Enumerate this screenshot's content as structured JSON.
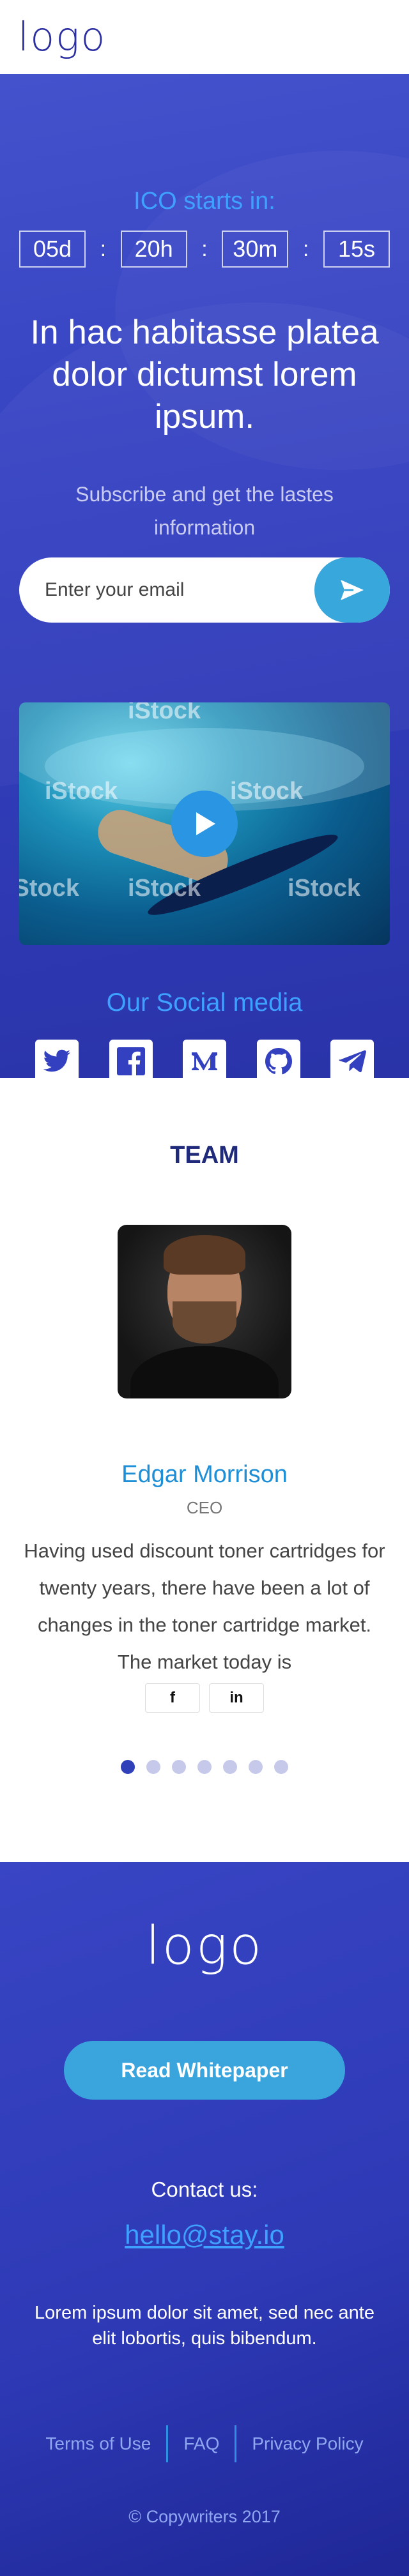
{
  "header": {
    "logo_text": "logo"
  },
  "hero": {
    "ico_title": "ICO starts in:",
    "countdown": [
      {
        "value": "05d"
      },
      {
        "value": "20h"
      },
      {
        "value": "30m"
      },
      {
        "value": "15s"
      }
    ],
    "countdown_separator": ":",
    "heading": "In hac habitasse platea dolor dictumst lorem ipsum.",
    "subscribe_text": "Subscribe and get the lastes information",
    "email_placeholder": "Enter your email",
    "video": {
      "watermark": "iStock"
    },
    "social_title": "Our Social media",
    "social_icons": [
      "twitter-icon",
      "facebook-icon",
      "medium-icon",
      "github-icon",
      "telegram-icon"
    ]
  },
  "team": {
    "title": "TEAM",
    "member": {
      "name": "Edgar Morrison",
      "role": "CEO",
      "bio": "Having used discount toner cartridges for twenty years, there have been a lot of changes in the toner cartridge market. The market today is",
      "social": [
        {
          "label": "f",
          "icon": "facebook-icon"
        },
        {
          "label": "in",
          "icon": "linkedin-icon"
        }
      ]
    },
    "carousel": {
      "count": 7,
      "active": 0
    }
  },
  "footer": {
    "logo_text": "logo",
    "whitepaper_label": "Read Whitepaper",
    "contact_label": "Contact us:",
    "contact_email": "hello@stay.io",
    "text": "Lorem ipsum dolor sit amet, sed nec ante elit lobortis, quis bibendum.",
    "links": [
      {
        "label": "Terms of Use"
      },
      {
        "label": "FAQ"
      },
      {
        "label": "Privacy Policy"
      }
    ],
    "copyright": "© Copywriters  2017"
  },
  "colors": {
    "brand_blue": "#3340c0",
    "accent_light_blue": "#3ea0ff",
    "button_blue": "#38a7dc",
    "logo_dark": "#2b2fa0"
  }
}
